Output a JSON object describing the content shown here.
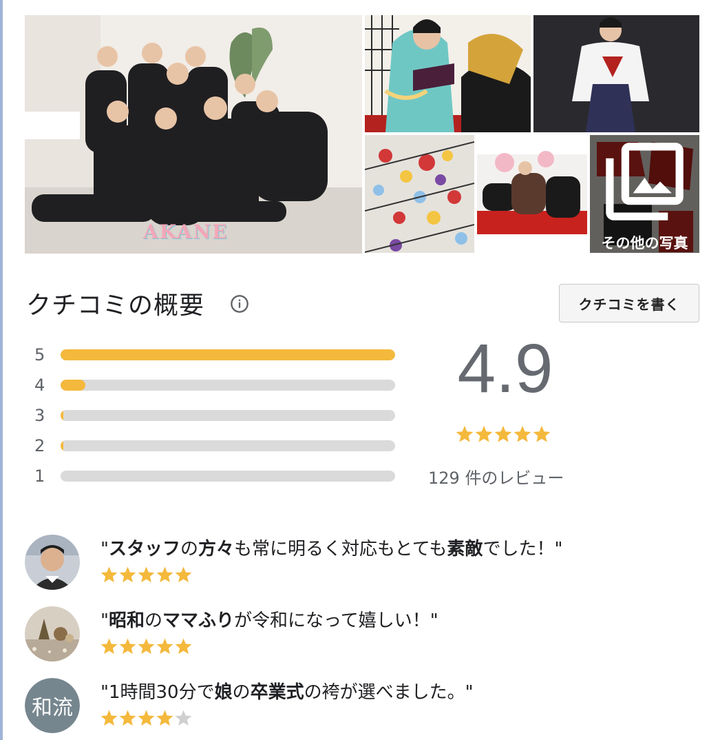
{
  "photos": {
    "watermark": "AKANE",
    "more_label": "その他の写真",
    "more_icon": "photo-library-icon"
  },
  "summary": {
    "title": "クチコミの概要",
    "info_icon": "info-icon",
    "write_button": "クチコミを書く",
    "histogram": [
      {
        "stars": "5",
        "fraction": 1.0
      },
      {
        "stars": "4",
        "fraction": 0.075
      },
      {
        "stars": "3",
        "fraction": 0.008
      },
      {
        "stars": "2",
        "fraction": 0.008
      },
      {
        "stars": "1",
        "fraction": 0.0
      }
    ],
    "score": "4.9",
    "score_stars": 5,
    "review_count": "129 件のレビュー"
  },
  "snippets": [
    {
      "avatar": "person-photo-avatar",
      "quote": [
        {
          "t": "\"",
          "b": false
        },
        {
          "t": "スタッフ",
          "b": true
        },
        {
          "t": "の",
          "b": false
        },
        {
          "t": "方々",
          "b": true
        },
        {
          "t": "も常に明るく対応もとても",
          "b": false
        },
        {
          "t": "素敵",
          "b": true
        },
        {
          "t": "でした！\"",
          "b": false
        }
      ],
      "rating": 5
    },
    {
      "avatar": "decor-photo-avatar",
      "quote": [
        {
          "t": "\"",
          "b": false
        },
        {
          "t": "昭和",
          "b": true
        },
        {
          "t": "の",
          "b": false
        },
        {
          "t": "ママふり",
          "b": true
        },
        {
          "t": "が令和になって嬉しい！\"",
          "b": false
        }
      ],
      "rating": 5
    },
    {
      "avatar_text": "和流",
      "quote": [
        {
          "t": "\"1時間30分で",
          "b": false
        },
        {
          "t": "娘",
          "b": true
        },
        {
          "t": "の",
          "b": false
        },
        {
          "t": "卒業式",
          "b": true
        },
        {
          "t": "の袴が選べました。\"",
          "b": false
        }
      ],
      "rating": 4
    }
  ],
  "colors": {
    "star_filled": "#f4b93c",
    "star_empty": "#d0d0d0",
    "bar_track": "#dadada",
    "avatar_bg": "#76868f"
  }
}
